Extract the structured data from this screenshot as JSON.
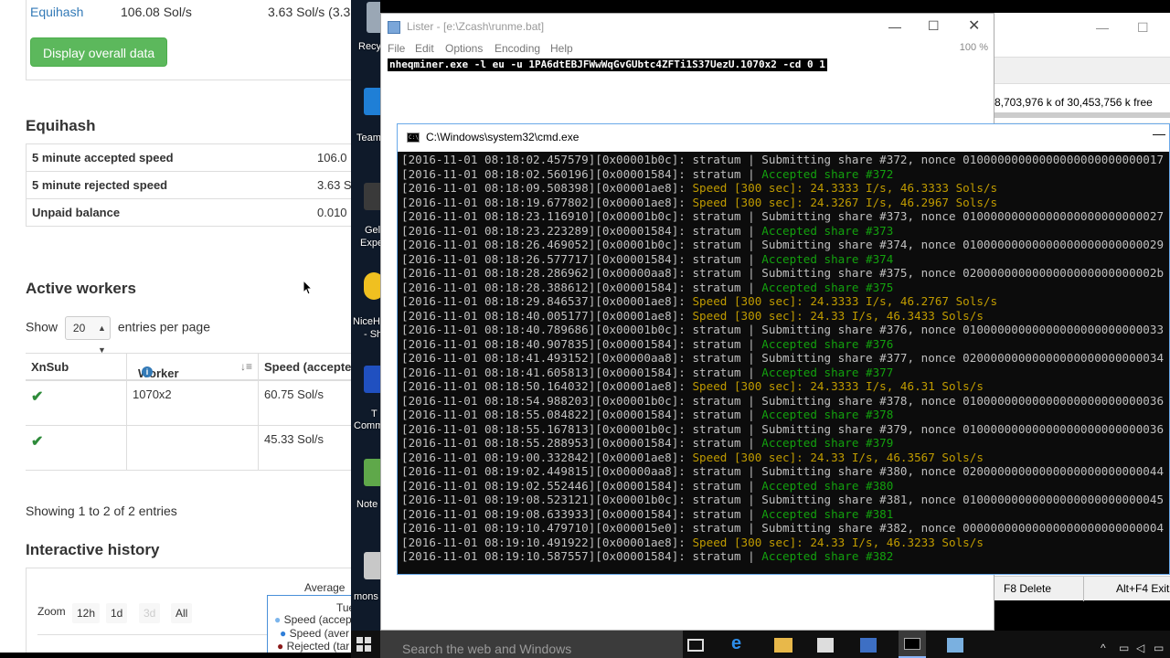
{
  "browser": {
    "top_row": {
      "pool": "Equihash",
      "accepted": "106.08 Sol/s",
      "rejected": "3.63 Sol/s (3.3"
    },
    "display_button": "Display overall data",
    "equihash": {
      "heading": "Equihash",
      "rows": [
        {
          "label": "5 minute accepted speed",
          "value": "106.0"
        },
        {
          "label": "5 minute rejected speed",
          "value": "3.63 S"
        },
        {
          "label": "Unpaid balance",
          "value": "0.010"
        }
      ]
    },
    "workers": {
      "heading": "Active workers",
      "show_prefix": "Show",
      "entries_value": "20",
      "show_suffix": "entries per page",
      "columns": [
        "XnSub",
        "Worker",
        "Speed (accepte"
      ],
      "rows": [
        {
          "xnsub": "✔",
          "worker": "1070x2",
          "speed": "60.75 Sol/s"
        },
        {
          "xnsub": "✔",
          "worker": "",
          "speed": "45.33 Sol/s"
        }
      ],
      "showing": "Showing 1 to 2 of 2 entries"
    },
    "history": {
      "heading": "Interactive history",
      "zoom_label": "Zoom",
      "zoom_buttons": [
        "12h",
        "1d",
        "3d",
        "All"
      ],
      "average_label": "Average",
      "tooltip": {
        "title": "Tue",
        "l1": "Speed (accep",
        "l2": "Speed (aver",
        "l3": "Rejected (tar"
      }
    }
  },
  "desktop": {
    "labels": [
      "Recy",
      "Team",
      "Gel",
      "Expe",
      "NiceH",
      "- Sh",
      "T",
      "Comm",
      "Note",
      "mons"
    ]
  },
  "lister": {
    "title": "Lister - [e:\\Zcash\\runme.bat]",
    "menu": [
      "File",
      "Edit",
      "Options",
      "Encoding",
      "Help"
    ],
    "percent": "100 %",
    "content": "nheqminer.exe -l eu -u 1PA6dtEBJFWwWqGvGUbtc4ZFTi1S37UezU.1070x2 -cd 0 1"
  },
  "backwin": {
    "free_space": "8,703,976 k of 30,453,756 k free",
    "f8": "F8 Delete",
    "altf4": "Alt+F4 Exit"
  },
  "cmd": {
    "title": "C:\\Windows\\system32\\cmd.exe",
    "lines": [
      {
        "pre": "[2016-11-01 08:18:02.457579][0x00001b0c]: stratum | ",
        "text": "Submitting share #372, nonce 01000000000000000000000000017",
        "c": ""
      },
      {
        "pre": "[2016-11-01 08:18:02.560196][0x00001584]: stratum | ",
        "text": "Accepted share #372",
        "c": "g"
      },
      {
        "pre": "[2016-11-01 08:18:09.508398][0x00001ae8]: ",
        "text": "Speed [300 sec]: 24.3333 I/s, 46.3333 Sols/s",
        "c": "y"
      },
      {
        "pre": "[2016-11-01 08:18:19.677802][0x00001ae8]: ",
        "text": "Speed [300 sec]: 24.3267 I/s, 46.2967 Sols/s",
        "c": "y"
      },
      {
        "pre": "[2016-11-01 08:18:23.116910][0x00001b0c]: stratum | ",
        "text": "Submitting share #373, nonce 01000000000000000000000000027",
        "c": ""
      },
      {
        "pre": "[2016-11-01 08:18:23.223289][0x00001584]: stratum | ",
        "text": "Accepted share #373",
        "c": "g"
      },
      {
        "pre": "[2016-11-01 08:18:26.469052][0x00001b0c]: stratum | ",
        "text": "Submitting share #374, nonce 01000000000000000000000000029",
        "c": ""
      },
      {
        "pre": "[2016-11-01 08:18:26.577717][0x00001584]: stratum | ",
        "text": "Accepted share #374",
        "c": "g"
      },
      {
        "pre": "[2016-11-01 08:18:28.286962][0x00000aa8]: stratum | ",
        "text": "Submitting share #375, nonce 0200000000000000000000000002b",
        "c": ""
      },
      {
        "pre": "[2016-11-01 08:18:28.388612][0x00001584]: stratum | ",
        "text": "Accepted share #375",
        "c": "g"
      },
      {
        "pre": "[2016-11-01 08:18:29.846537][0x00001ae8]: ",
        "text": "Speed [300 sec]: 24.3333 I/s, 46.2767 Sols/s",
        "c": "y"
      },
      {
        "pre": "[2016-11-01 08:18:40.005177][0x00001ae8]: ",
        "text": "Speed [300 sec]: 24.33 I/s, 46.3433 Sols/s",
        "c": "y"
      },
      {
        "pre": "[2016-11-01 08:18:40.789686][0x00001b0c]: stratum | ",
        "text": "Submitting share #376, nonce 01000000000000000000000000033",
        "c": ""
      },
      {
        "pre": "[2016-11-01 08:18:40.907835][0x00001584]: stratum | ",
        "text": "Accepted share #376",
        "c": "g"
      },
      {
        "pre": "[2016-11-01 08:18:41.493152][0x00000aa8]: stratum | ",
        "text": "Submitting share #377, nonce 02000000000000000000000000034",
        "c": ""
      },
      {
        "pre": "[2016-11-01 08:18:41.605813][0x00001584]: stratum | ",
        "text": "Accepted share #377",
        "c": "g"
      },
      {
        "pre": "[2016-11-01 08:18:50.164032][0x00001ae8]: ",
        "text": "Speed [300 sec]: 24.3333 I/s, 46.31 Sols/s",
        "c": "y"
      },
      {
        "pre": "[2016-11-01 08:18:54.988203][0x00001b0c]: stratum | ",
        "text": "Submitting share #378, nonce 01000000000000000000000000036",
        "c": ""
      },
      {
        "pre": "[2016-11-01 08:18:55.084822][0x00001584]: stratum | ",
        "text": "Accepted share #378",
        "c": "g"
      },
      {
        "pre": "[2016-11-01 08:18:55.167813][0x00001b0c]: stratum | ",
        "text": "Submitting share #379, nonce 01000000000000000000000000036",
        "c": ""
      },
      {
        "pre": "[2016-11-01 08:18:55.288953][0x00001584]: stratum | ",
        "text": "Accepted share #379",
        "c": "g"
      },
      {
        "pre": "[2016-11-01 08:19:00.332842][0x00001ae8]: ",
        "text": "Speed [300 sec]: 24.33 I/s, 46.3567 Sols/s",
        "c": "y"
      },
      {
        "pre": "[2016-11-01 08:19:02.449815][0x00000aa8]: stratum | ",
        "text": "Submitting share #380, nonce 02000000000000000000000000044",
        "c": ""
      },
      {
        "pre": "[2016-11-01 08:19:02.552446][0x00001584]: stratum | ",
        "text": "Accepted share #380",
        "c": "g"
      },
      {
        "pre": "[2016-11-01 08:19:08.523121][0x00001b0c]: stratum | ",
        "text": "Submitting share #381, nonce 01000000000000000000000000045",
        "c": ""
      },
      {
        "pre": "[2016-11-01 08:19:08.633933][0x00001584]: stratum | ",
        "text": "Accepted share #381",
        "c": "g"
      },
      {
        "pre": "[2016-11-01 08:19:10.479710][0x000015e0]: stratum | ",
        "text": "Submitting share #382, nonce 00000000000000000000000000004",
        "c": ""
      },
      {
        "pre": "[2016-11-01 08:19:10.491922][0x00001ae8]: ",
        "text": "Speed [300 sec]: 24.33 I/s, 46.3233 Sols/s",
        "c": "y"
      },
      {
        "pre": "[2016-11-01 08:19:10.587557][0x00001584]: stratum | ",
        "text": "Accepted share #382",
        "c": "g"
      }
    ]
  },
  "taskbar": {
    "search_placeholder": "Search the web and Windows"
  }
}
